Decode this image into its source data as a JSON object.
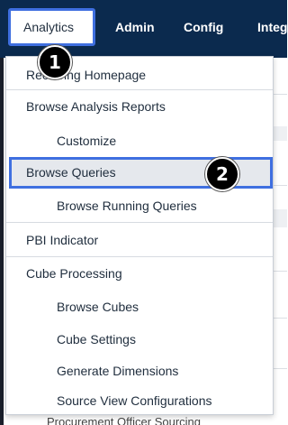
{
  "navbar": {
    "items": [
      {
        "label": "Analytics",
        "active": true
      },
      {
        "label": "Admin"
      },
      {
        "label": "Config"
      },
      {
        "label": "Integ"
      }
    ]
  },
  "menu": {
    "items": [
      {
        "label": "Recurring Homepage",
        "level": 0
      },
      {
        "label": "Browse Analysis Reports",
        "level": 0
      },
      {
        "label": "Customize",
        "level": 1
      },
      {
        "label": "Browse Queries",
        "level": 0,
        "highlighted": true
      },
      {
        "label": "Browse Running Queries",
        "level": 1
      },
      {
        "label": "PBI Indicator",
        "level": 0
      },
      {
        "label": "Cube Processing",
        "level": 0
      },
      {
        "label": "Browse Cubes",
        "level": 1
      },
      {
        "label": "Cube Settings",
        "level": 1
      },
      {
        "label": "Generate Dimensions",
        "level": 1
      },
      {
        "label": "Source View Configurations",
        "level": 1
      }
    ]
  },
  "background": {
    "cutoff_text": "Procurement Officer Sourcing"
  },
  "badges": {
    "step1": "1",
    "step2": "2"
  },
  "colors": {
    "navbar_bg": "#0b2a4e",
    "highlight_border": "#3f6fe0",
    "highlight_bg": "#e5e8ed",
    "badge_bg": "#000000"
  }
}
